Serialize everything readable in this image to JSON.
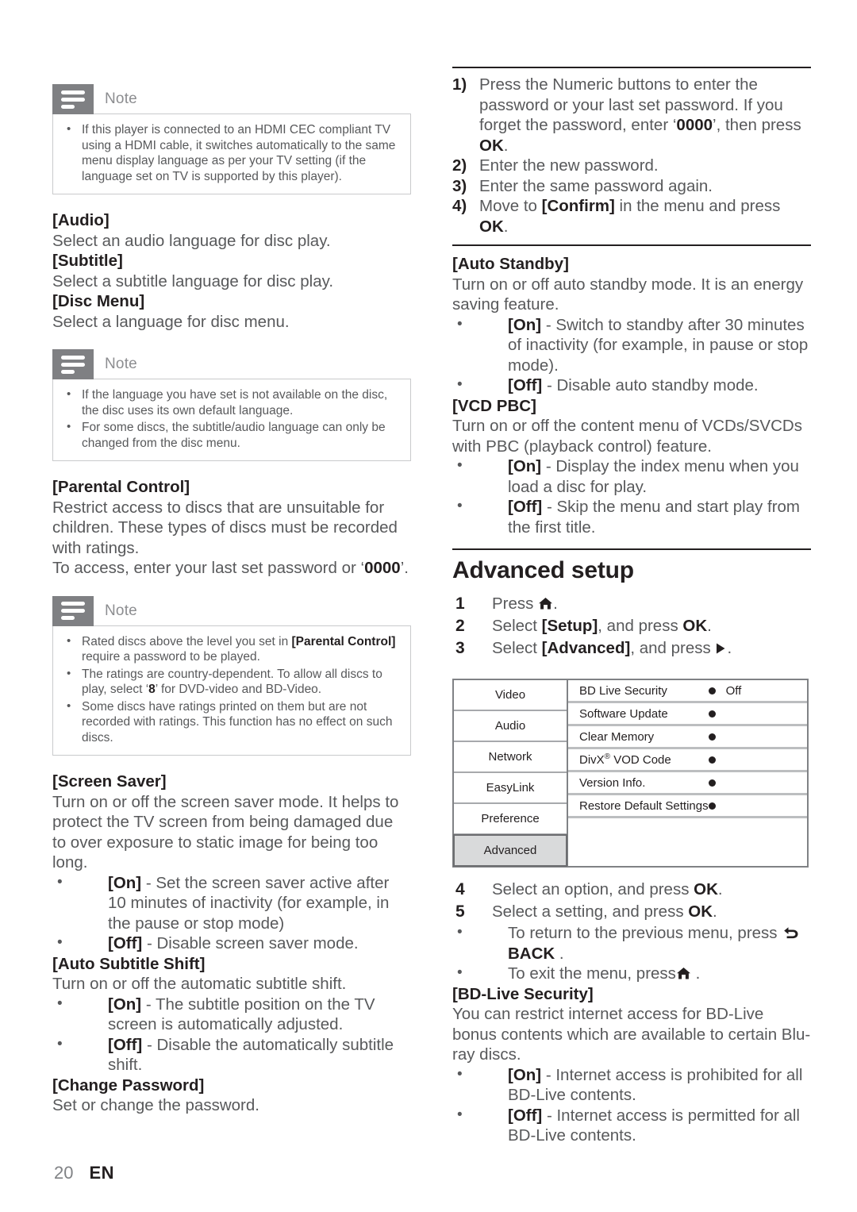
{
  "page": {
    "number": "20",
    "language": "EN"
  },
  "left_column": {
    "note_hdmi": {
      "title": "Note",
      "items": [
        "If this player is connected to an HDMI CEC compliant TV using a HDMI cable, it switches automatically to the same menu display language as per your TV setting (if the language set on TV is supported by this player)."
      ]
    },
    "audio": {
      "heading": "[Audio]",
      "text": "Select an audio language for disc play."
    },
    "subtitle": {
      "heading": "[Subtitle]",
      "text": "Select a subtitle language for disc play."
    },
    "disc_menu": {
      "heading": "[Disc Menu]",
      "text": "Select a language for disc menu."
    },
    "note_language": {
      "title": "Note",
      "items": [
        "If the language you have set is not available on the disc, the disc uses its own default language.",
        "For some discs, the subtitle/audio language can only be changed from the disc menu."
      ]
    },
    "parental_control": {
      "heading": "[Parental Control]",
      "text": "Restrict access to discs that are unsuitable for children. These types of discs must be recorded with ratings.",
      "access_prefix": "To access, enter your last set password or ‘",
      "access_password": "0000",
      "access_suffix": "’."
    },
    "note_ratings": {
      "title": "Note",
      "items": [
        {
          "pre": "Rated discs above the level you set in ",
          "bold": "[Parental Control]",
          "post": " require a password to be played."
        },
        {
          "pre": "The ratings are country-dependent. To allow all discs to play, select ‘",
          "bold": "8",
          "post": "’ for DVD-video and BD-Video."
        },
        {
          "pre": "Some discs have ratings printed on them but are not recorded with ratings. This function has no effect on such discs.",
          "bold": "",
          "post": ""
        }
      ]
    },
    "screen_saver": {
      "heading": "[Screen Saver]",
      "text": "Turn on or off the screen saver mode. It helps to protect the TV screen from being damaged due to over exposure to static image for being too long.",
      "options": [
        {
          "label": "[On]",
          "desc": " - Set the screen saver active after 10 minutes of inactivity (for example, in the pause or stop mode)"
        },
        {
          "label": "[Off]",
          "desc": " - Disable screen saver mode."
        }
      ]
    },
    "auto_subtitle_shift": {
      "heading": "[Auto Subtitle Shift]",
      "text": "Turn on or off the automatic subtitle shift.",
      "options": [
        {
          "label": "[On]",
          "desc": " - The subtitle position on the TV screen is automatically adjusted."
        },
        {
          "label": "[Off]",
          "desc": " - Disable the automatically subtitle shift."
        }
      ]
    },
    "change_password": {
      "heading": "[Change Password]",
      "text": "Set or change the password."
    }
  },
  "right_column": {
    "password_steps": [
      {
        "n": "1)",
        "pre": "Press the Numeric buttons to enter the password or your last set password. If you forget the password, enter ‘",
        "bold1": "0000",
        "mid": "’, then press ",
        "bold2": "OK",
        "post": "."
      },
      {
        "n": "2)",
        "pre": "Enter the new password.",
        "bold1": "",
        "mid": "",
        "bold2": "",
        "post": ""
      },
      {
        "n": "3)",
        "pre": "Enter the same password again.",
        "bold1": "",
        "mid": "",
        "bold2": "",
        "post": ""
      },
      {
        "n": "4)",
        "pre": "Move to ",
        "bold1": "[Confirm]",
        "mid": " in the menu and press ",
        "bold2": "OK",
        "post": "."
      }
    ],
    "auto_standby": {
      "heading": "[Auto Standby]",
      "text": "Turn on or off auto standby mode. It is an energy saving feature.",
      "options": [
        {
          "label": "[On]",
          "desc": " - Switch to standby after 30 minutes of inactivity (for example, in pause or stop mode)."
        },
        {
          "label": "[Off]",
          "desc": " - Disable auto standby mode."
        }
      ]
    },
    "vcd_pbc": {
      "heading": "[VCD PBC]",
      "text": "Turn on or off the content menu of VCDs/SVCDs with PBC (playback control) feature.",
      "options": [
        {
          "label": "[On]",
          "desc": " - Display the index menu when you load a disc for play."
        },
        {
          "label": "[Off]",
          "desc": " - Skip the menu and start play from the first title."
        }
      ]
    },
    "advanced_setup": {
      "title": "Advanced setup",
      "steps_before": [
        {
          "n": "1",
          "pre": "Press ",
          "icon": "home-icon",
          "bold": "",
          "mid": "",
          "bold2": "",
          "post": "."
        },
        {
          "n": "2",
          "pre": "Select ",
          "icon": "",
          "bold": "[Setup]",
          "mid": ", and press ",
          "bold2": "OK",
          "post": "."
        },
        {
          "n": "3",
          "pre": "Select ",
          "icon": "",
          "bold": "[Advanced]",
          "mid": ", and press ",
          "bold2": "",
          "post": "",
          "trailing_icon": "right-arrow-icon",
          "trailing_post": "."
        }
      ],
      "steps_after": [
        {
          "n": "4",
          "pre": "Select an option, and press ",
          "bold": "OK",
          "post": "."
        },
        {
          "n": "5",
          "pre": "Select a setting, and press ",
          "bold": "OK",
          "post": "."
        }
      ],
      "sub_bullets": [
        {
          "pre": "To return to the previous menu, press ",
          "icon": "back-arrow-icon",
          "bold": "BACK",
          "post": " ."
        },
        {
          "pre": "To exit the menu, press",
          "icon": "home-icon",
          "bold": "",
          "post": " ."
        }
      ]
    },
    "tv_menu": {
      "left_items": [
        {
          "label": "Video",
          "selected": false
        },
        {
          "label": "Audio",
          "selected": false
        },
        {
          "label": "Network",
          "selected": false
        },
        {
          "label": "EasyLink",
          "selected": false
        },
        {
          "label": "Preference",
          "selected": false
        },
        {
          "label": "Advanced",
          "selected": true
        }
      ],
      "rows": [
        {
          "label": "BD Live Security",
          "label_sup": "",
          "label_post": "",
          "value": "Off"
        },
        {
          "label": "Software Update",
          "label_sup": "",
          "label_post": "",
          "value": ""
        },
        {
          "label": "Clear Memory",
          "label_sup": "",
          "label_post": "",
          "value": ""
        },
        {
          "label": "DivX",
          "label_sup": "®",
          "label_post": " VOD Code",
          "value": ""
        },
        {
          "label": "Version Info.",
          "label_sup": "",
          "label_post": "",
          "value": ""
        },
        {
          "label": "Restore Default Settings",
          "label_sup": "",
          "label_post": "",
          "value": ""
        }
      ]
    },
    "bd_live_security": {
      "heading": "[BD-Live Security]",
      "text": "You can restrict internet access for BD-Live bonus contents which are available to certain Blu-ray discs.",
      "options": [
        {
          "label": "[On]",
          "desc": " - Internet access is prohibited for all BD-Live contents."
        },
        {
          "label": "[Off]",
          "desc": " - Internet access is permitted for all BD-Live contents."
        }
      ]
    }
  }
}
